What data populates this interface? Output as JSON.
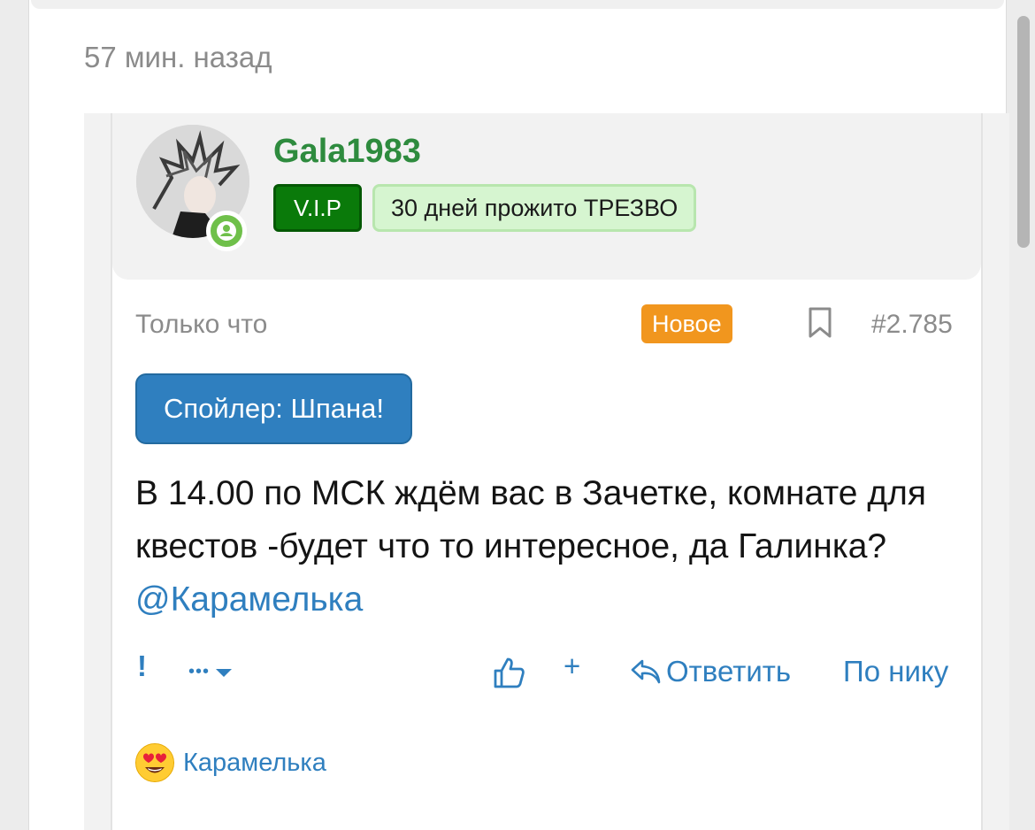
{
  "previous_post": {
    "time_ago": "57 мин. назад"
  },
  "post": {
    "user": {
      "name": "Gala1983",
      "badges": [
        {
          "label": "V.I.P"
        },
        {
          "label": "30 дней прожито ТРЕЗВО"
        }
      ],
      "status": "online"
    },
    "meta": {
      "time": "Только что",
      "new_badge": "Новое",
      "number": "#2.785"
    },
    "spoiler_button": "Спойлер: Шпана!",
    "message_text": "В 14.00 по МСК ждём вас в Зачетке, комнате для квестов -будет что то интересное, да Галинка?",
    "mention": "@Карамелька",
    "actions": {
      "report": "!",
      "more": "•••",
      "plus": "+",
      "reply": "Ответить",
      "by_nick": "По нику"
    },
    "reaction": {
      "emoji": "heart-eyes-emoji",
      "user": "Карамелька"
    }
  },
  "colors": {
    "link": "#2f7fbf",
    "username": "#2e8b3e",
    "vip_bg": "#0a7a0a",
    "sober_bg": "#d6f5d0",
    "new_badge": "#f1961e",
    "online": "#6fc04a"
  }
}
